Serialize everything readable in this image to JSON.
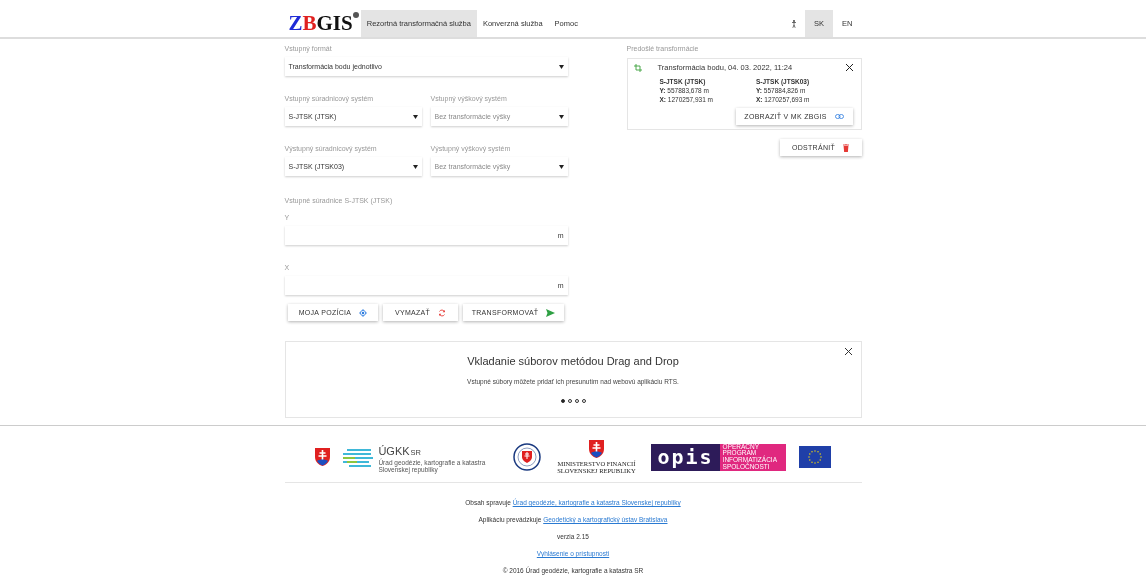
{
  "header": {
    "logo": [
      {
        "text": "Z",
        "color": "#1f2bd6"
      },
      {
        "text": "B",
        "color": "#e0201f"
      },
      {
        "text": "GIS",
        "color": "#111111"
      }
    ],
    "nav": [
      {
        "label": "Rezortná transformačná služba",
        "selected": true
      },
      {
        "label": "Konverzná služba",
        "selected": false
      },
      {
        "label": "Pomoc",
        "selected": false
      }
    ],
    "languages": [
      {
        "label": "SK",
        "selected": true
      },
      {
        "label": "EN",
        "selected": false
      }
    ]
  },
  "form": {
    "format": {
      "label": "Vstupný formát",
      "value": "Transformácia bodu jednotlivo",
      "disabled": false
    },
    "rows": [
      [
        {
          "label": "Vstupný súradnicový systém",
          "value": "S-JTSK (JTSK)",
          "disabled": false
        },
        {
          "label": "Vstupný výškový systém",
          "value": "Bez transformácie výšky",
          "disabled": true
        }
      ],
      [
        {
          "label": "Výstupný súradnicový systém",
          "value": "S-JTSK (JTSK03)",
          "disabled": false
        },
        {
          "label": "Výstupný výškový systém",
          "value": "Bez transformácie výšky",
          "disabled": true
        }
      ]
    ],
    "coords_title": "Vstupné súradnice S-JTSK (JTSK)",
    "inputs": [
      {
        "label": "Y",
        "unit": "m"
      },
      {
        "label": "X",
        "unit": "m"
      }
    ],
    "buttons": [
      {
        "label": "MOJA POZÍCIA",
        "kind": "locate"
      },
      {
        "label": "VYMAZAŤ",
        "kind": "clear"
      },
      {
        "label": "TRANSFORMOVAŤ",
        "kind": "send"
      }
    ]
  },
  "history": {
    "title": "Predošlé transformácie",
    "item": {
      "title": "Transformácia bodu, 04. 03. 2022, 11:24",
      "systems": [
        {
          "name": "S-JTSK (JTSK)",
          "y_label": "Y:",
          "y": "557883,678 m",
          "x_label": "X:",
          "x": "1270257,931 m"
        },
        {
          "name": "S-JTSK (JTSK03)",
          "y_label": "Y:",
          "y": "557884,826 m",
          "x_label": "X:",
          "x": "1270257,693 m"
        }
      ],
      "button": "ZOBRAZIŤ V MK ZBGIS"
    },
    "remove": "ODSTRÁNIŤ"
  },
  "carousel": {
    "title": "Vkladanie súborov metódou Drag and Drop",
    "text": "Vstupné súbory môžete pridať ich presunutím nad webovú aplikáciu RTS.",
    "dots": [
      {
        "selected": true
      },
      {
        "selected": false
      },
      {
        "selected": false
      },
      {
        "selected": false
      }
    ]
  },
  "logos": {
    "ugkk": "ÚGKK",
    "ugkk_sub": "SR",
    "ugkk_caption": "Úrad geodézie, kartografie a katastra Slovenskej republiky",
    "ministry": "MINISTERSTVO FINANCIÍ SLOVENSKEJ REPUBLIKY",
    "opis": "opis",
    "opis_caption": "OPERAČNÝ PROGRAM INFORMATIZÁCIA SPOLOČNOSTI"
  },
  "footer": [
    {
      "kind": "link",
      "prefix": "Obsah spravuje",
      "link": "Úrad geodézie, kartografie a katastra Slovenskej republiky"
    },
    {
      "kind": "link",
      "prefix": "Aplikáciu prevádzkuje",
      "link": "Geodetický a kartografický ústav Bratislava"
    },
    {
      "kind": "text",
      "text": "verzia 2.15"
    },
    {
      "kind": "link",
      "link": "Vyhlásenie o prístupnosti"
    },
    {
      "kind": "text",
      "text": "© 2016 Úrad geodézie, kartografie a katastra SR"
    }
  ]
}
